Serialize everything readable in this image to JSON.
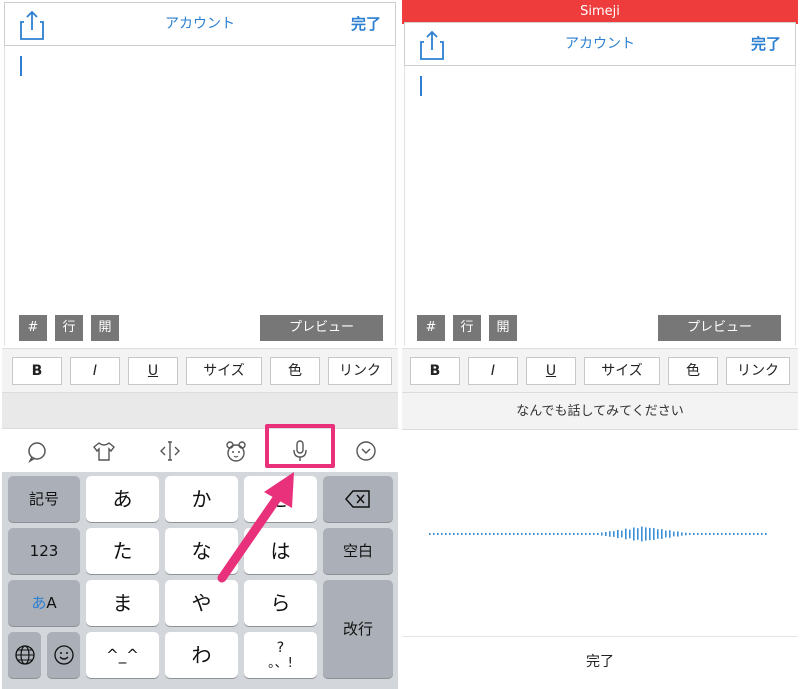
{
  "left": {
    "nav": {
      "title": "アカウント",
      "done": "完了"
    },
    "mini_buttons": [
      "#",
      "行",
      "開"
    ],
    "preview": "プレビュー",
    "format_buttons": [
      "B",
      "I",
      "U",
      "サイズ",
      "色",
      "リンク"
    ],
    "toolbar_icons": [
      "chat-bubble-icon",
      "tshirt-icon",
      "cursor-move-icon",
      "bear-face-icon",
      "microphone-icon",
      "chevron-down-circle-icon"
    ],
    "keyboard": {
      "row1": [
        "記号",
        "あ",
        "か",
        "さ"
      ],
      "row2": [
        "123",
        "た",
        "な",
        "は",
        "空白"
      ],
      "row3": [
        "あ",
        "A",
        "ま",
        "や",
        "ら",
        "改行"
      ],
      "row4": [
        "^_^",
        "わ",
        "?",
        "。、!"
      ]
    },
    "highlight_color": "#e8317a"
  },
  "right": {
    "app_label": "Simeji",
    "nav": {
      "title": "アカウント",
      "done": "完了"
    },
    "mini_buttons": [
      "#",
      "行",
      "開"
    ],
    "preview": "プレビュー",
    "format_buttons": [
      "B",
      "I",
      "U",
      "サイズ",
      "色",
      "リンク"
    ],
    "prompt": "なんでも話してみてください",
    "done_label": "完了"
  },
  "colors": {
    "accent": "#2d7fd1",
    "simeji_red": "#ee3b3b"
  }
}
